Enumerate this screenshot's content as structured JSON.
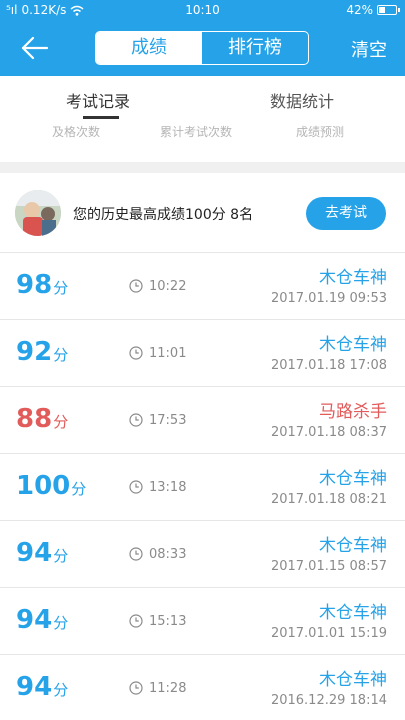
{
  "status_bar": {
    "signal": "⁵ıl",
    "speed": "0.12K/s",
    "time": "10:10",
    "battery": "42%",
    "battery_level": 0.42
  },
  "header": {
    "tabs": [
      "成绩",
      "排行榜"
    ],
    "active_tab": "成绩",
    "clear_label": "清空"
  },
  "subtabs": {
    "items": [
      "考试记录",
      "数据统计"
    ],
    "active": "考试记录",
    "stats": [
      "及格次数",
      "累计考试次数",
      "成绩预测"
    ]
  },
  "best": {
    "text": "您的历史最高成绩100分  8名",
    "button": "去考试"
  },
  "records": [
    {
      "score": "98",
      "unit": "分",
      "duration": "10:22",
      "title": "木仓车神",
      "date": "2017.01.19  09:53",
      "color": "#26a3e8"
    },
    {
      "score": "92",
      "unit": "分",
      "duration": "11:01",
      "title": "木仓车神",
      "date": "2017.01.18  17:08",
      "color": "#26a3e8"
    },
    {
      "score": "88",
      "unit": "分",
      "duration": "17:53",
      "title": "马路杀手",
      "date": "2017.01.18  08:37",
      "color": "#e25b5b"
    },
    {
      "score": "100",
      "unit": "分",
      "duration": "13:18",
      "title": "木仓车神",
      "date": "2017.01.18  08:21",
      "color": "#26a3e8"
    },
    {
      "score": "94",
      "unit": "分",
      "duration": "08:33",
      "title": "木仓车神",
      "date": "2017.01.15  08:57",
      "color": "#26a3e8"
    },
    {
      "score": "94",
      "unit": "分",
      "duration": "15:13",
      "title": "木仓车神",
      "date": "2017.01.01  15:19",
      "color": "#26a3e8"
    },
    {
      "score": "94",
      "unit": "分",
      "duration": "11:28",
      "title": "木仓车神",
      "date": "2016.12.29  18:14",
      "color": "#26a3e8"
    }
  ],
  "colors": {
    "accent": "#26a3e8",
    "fail": "#e25b5b"
  }
}
